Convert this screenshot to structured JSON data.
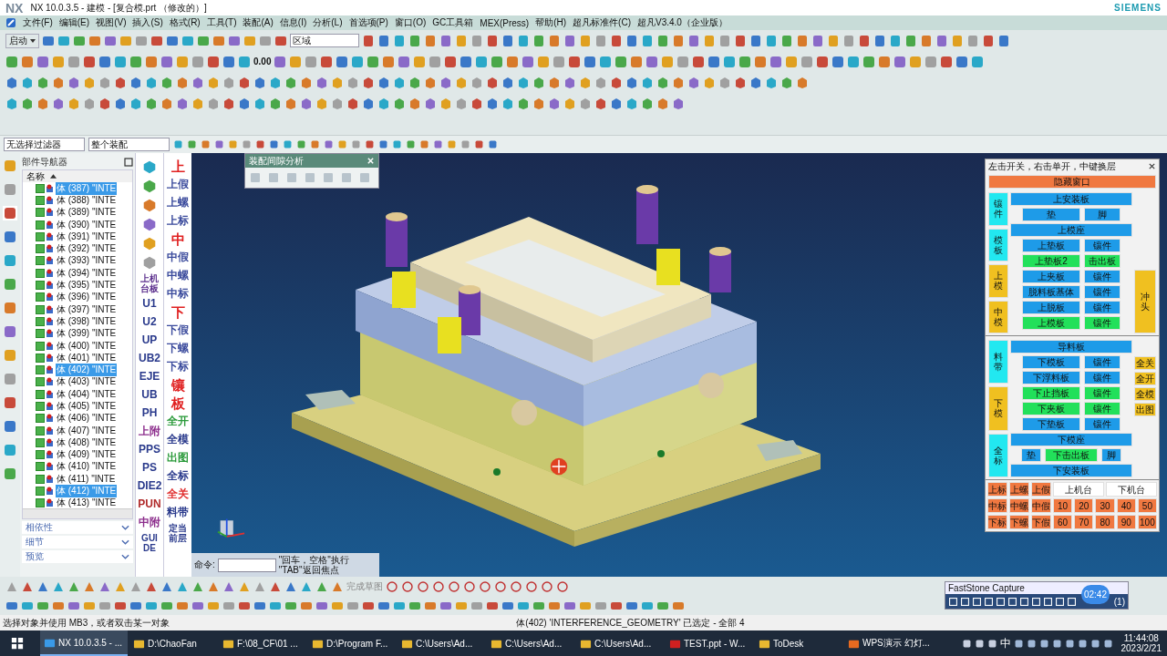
{
  "window": {
    "logo": "NX",
    "title": "NX 10.0.3.5 - 建模 - [复合模.prt （修改的）]",
    "brand": "SIEMENS"
  },
  "menu": [
    "文件(F)",
    "编辑(E)",
    "视图(V)",
    "插入(S)",
    "格式(R)",
    "工具(T)",
    "装配(A)",
    "信息(I)",
    "分析(L)",
    "首选项(P)",
    "窗口(O)",
    "GC工具箱",
    "MEX(Press)",
    "帮助(H)",
    "超凡标准件(C)",
    "超凡V3.4.0（企业版）"
  ],
  "toolbar": {
    "start": "启动",
    "region": "区域",
    "value": "0.00",
    "filter": "无选择过滤器",
    "scope": "整个装配"
  },
  "navigator": {
    "title": "部件导航器",
    "column": "名称",
    "rows": [
      {
        "label": "体 (387) \"INTE",
        "checked": true,
        "selected": true
      },
      {
        "label": "体 (388) \"INTE",
        "checked": true,
        "selected": false
      },
      {
        "label": "体 (389) \"INTE",
        "checked": true,
        "selected": false
      },
      {
        "label": "体 (390) \"INTE",
        "checked": true,
        "selected": false
      },
      {
        "label": "体 (391) \"INTE",
        "checked": true,
        "selected": false
      },
      {
        "label": "体 (392) \"INTE",
        "checked": true,
        "selected": false
      },
      {
        "label": "体 (393) \"INTE",
        "checked": true,
        "selected": false
      },
      {
        "label": "体 (394) \"INTE",
        "checked": true,
        "selected": false
      },
      {
        "label": "体 (395) \"INTE",
        "checked": true,
        "selected": false
      },
      {
        "label": "体 (396) \"INTE",
        "checked": true,
        "selected": false
      },
      {
        "label": "体 (397) \"INTE",
        "checked": true,
        "selected": false
      },
      {
        "label": "体 (398) \"INTE",
        "checked": true,
        "selected": false
      },
      {
        "label": "体 (399) \"INTE",
        "checked": true,
        "selected": false
      },
      {
        "label": "体 (400) \"INTE",
        "checked": true,
        "selected": false
      },
      {
        "label": "体 (401) \"INTE",
        "checked": true,
        "selected": false
      },
      {
        "label": "体 (402) \"INTE",
        "checked": true,
        "selected": true
      },
      {
        "label": "体 (403) \"INTE",
        "checked": true,
        "selected": false
      },
      {
        "label": "体 (404) \"INTE",
        "checked": true,
        "selected": false
      },
      {
        "label": "体 (405) \"INTE",
        "checked": true,
        "selected": false
      },
      {
        "label": "体 (406) \"INTE",
        "checked": true,
        "selected": false
      },
      {
        "label": "体 (407) \"INTE",
        "checked": true,
        "selected": false
      },
      {
        "label": "体 (408) \"INTE",
        "checked": true,
        "selected": false
      },
      {
        "label": "体 (409) \"INTE",
        "checked": true,
        "selected": false
      },
      {
        "label": "体 (410) \"INTE",
        "checked": true,
        "selected": false
      },
      {
        "label": "体 (411) \"INTE",
        "checked": true,
        "selected": false
      },
      {
        "label": "体 (412) \"INTE",
        "checked": true,
        "selected": true
      },
      {
        "label": "体 (413) \"INTE",
        "checked": true,
        "selected": false
      }
    ],
    "sections": [
      {
        "label": "相依性",
        "expanded": false
      },
      {
        "label": "细节",
        "expanded": false
      },
      {
        "label": "预览",
        "expanded": false
      }
    ]
  },
  "vertical_toolbars": [
    [
      {
        "kind": "icon"
      },
      {
        "kind": "icon"
      },
      {
        "kind": "icon"
      },
      {
        "kind": "icon"
      },
      {
        "kind": "icon"
      },
      {
        "kind": "icon"
      },
      {
        "kind": "small",
        "label": "上机台板",
        "color": "#5a2d8c"
      },
      {
        "kind": "text",
        "label": "U1",
        "color": "#2a3a8c"
      },
      {
        "kind": "text",
        "label": "U2",
        "color": "#2a3a8c"
      },
      {
        "kind": "text",
        "label": "UP",
        "color": "#2a3a8c"
      },
      {
        "kind": "text",
        "label": "UB2",
        "color": "#2a3a8c"
      },
      {
        "kind": "text",
        "label": "EJE",
        "color": "#2a3a8c"
      },
      {
        "kind": "text",
        "label": "UB",
        "color": "#2a3a8c"
      },
      {
        "kind": "text",
        "label": "PH",
        "color": "#2a3a8c"
      },
      {
        "kind": "text",
        "label": "上附",
        "color": "#8c2d8c"
      },
      {
        "kind": "text",
        "label": "PPS",
        "color": "#2a3a8c"
      },
      {
        "kind": "text",
        "label": "PS",
        "color": "#2a3a8c"
      },
      {
        "kind": "text",
        "label": "DIE2",
        "color": "#2a3a8c"
      },
      {
        "kind": "text",
        "label": "PUN",
        "color": "#b02a2a"
      },
      {
        "kind": "text",
        "label": "中附",
        "color": "#8c2d8c"
      },
      {
        "kind": "small",
        "label": "GUIDE",
        "color": "#2a3a8c"
      }
    ],
    [
      {
        "kind": "big",
        "label": "上",
        "color": "#e02020"
      },
      {
        "kind": "text",
        "label": "上假",
        "color": "#3a4a9c"
      },
      {
        "kind": "text",
        "label": "上螺",
        "color": "#3a4a9c"
      },
      {
        "kind": "text",
        "label": "上标",
        "color": "#3a4a9c"
      },
      {
        "kind": "big",
        "label": "中",
        "color": "#e02020"
      },
      {
        "kind": "text",
        "label": "中假",
        "color": "#3a4a9c"
      },
      {
        "kind": "text",
        "label": "中螺",
        "color": "#3a4a9c"
      },
      {
        "kind": "text",
        "label": "中标",
        "color": "#3a4a9c"
      },
      {
        "kind": "big",
        "label": "下",
        "color": "#e02020"
      },
      {
        "kind": "text",
        "label": "下假",
        "color": "#3a4a9c"
      },
      {
        "kind": "text",
        "label": "下螺",
        "color": "#3a4a9c"
      },
      {
        "kind": "text",
        "label": "下标",
        "color": "#3a4a9c"
      },
      {
        "kind": "big",
        "label": "镶",
        "color": "#e02020"
      },
      {
        "kind": "big",
        "label": "板",
        "color": "#e02020"
      },
      {
        "kind": "text",
        "label": "全开",
        "color": "#2a9a3a"
      },
      {
        "kind": "text",
        "label": "全模",
        "color": "#2a3a8c"
      },
      {
        "kind": "text",
        "label": "出图",
        "color": "#2a9a3a"
      },
      {
        "kind": "text",
        "label": "全标",
        "color": "#2a3a8c"
      },
      {
        "kind": "text",
        "label": "全关",
        "color": "#e03030"
      },
      {
        "kind": "text",
        "label": "料带",
        "color": "#2a3a8c"
      },
      {
        "kind": "small",
        "label": "定当前层",
        "color": "#2a3a8c"
      }
    ]
  ],
  "analysis_dialog": {
    "title": "装配间隙分析"
  },
  "command": {
    "label": "命令:",
    "hint": "\"回车，空格\"执行 \"TAB\"返回焦点"
  },
  "layer_panel": {
    "title": "左击开关，右击单开，中键换层",
    "hide": {
      "label": "隐藏窗口",
      "color": "#f07840"
    },
    "upper": {
      "side": [
        {
          "label": "镶件",
          "color": "#22e8f0"
        },
        {
          "label": "模板",
          "color": "#22e8f0"
        },
        {
          "label": "上模",
          "color": "#f0c020"
        },
        {
          "label": "中模",
          "color": "#f0c020"
        }
      ],
      "rows": [
        [
          {
            "label": "上安装板",
            "color": "#1e9be8"
          }
        ],
        [
          {
            "label": "垫",
            "color": "#1e9be8"
          },
          {
            "label": "脚",
            "color": "#1e9be8"
          }
        ],
        [
          {
            "label": "上模座",
            "color": "#1e9be8"
          }
        ],
        [
          {
            "label": "上垫板",
            "color": "#1e9be8"
          },
          {
            "label": "镶件",
            "color": "#1e9be8"
          }
        ],
        [
          {
            "label": "上垫板2",
            "color": "#22e05a"
          },
          {
            "label": "击出板",
            "color": "#22e05a"
          }
        ],
        [
          {
            "label": "上夹板",
            "color": "#1e9be8"
          },
          {
            "label": "镶件",
            "color": "#1e9be8"
          }
        ],
        [
          {
            "label": "脱料板基体",
            "color": "#1e9be8"
          },
          {
            "label": "镶件",
            "color": "#1e9be8"
          }
        ],
        [
          {
            "label": "上脱板",
            "color": "#1e9be8"
          },
          {
            "label": "镶件",
            "color": "#1e9be8"
          }
        ],
        [
          {
            "label": "上模板",
            "color": "#22e05a"
          },
          {
            "label": "镶件",
            "color": "#22e05a"
          }
        ]
      ],
      "right": [
        {
          "label": "冲头",
          "color": "#f0c020"
        }
      ]
    },
    "lower": {
      "side": [
        {
          "label": "料带",
          "color": "#22e8f0"
        },
        {
          "label": "下模",
          "color": "#f0c020"
        },
        {
          "label": "全标",
          "color": "#22e8f0"
        }
      ],
      "rows": [
        [
          {
            "label": "导料板",
            "color": "#1e9be8"
          }
        ],
        [
          {
            "label": "下模板",
            "color": "#1e9be8"
          },
          {
            "label": "镶件",
            "color": "#1e9be8"
          }
        ],
        [
          {
            "label": "下浮料板",
            "color": "#1e9be8"
          },
          {
            "label": "镶件",
            "color": "#1e9be8"
          }
        ],
        [
          {
            "label": "下止挡板",
            "color": "#22e05a"
          },
          {
            "label": "镶件",
            "color": "#22e05a"
          }
        ],
        [
          {
            "label": "下夹板",
            "color": "#22e05a"
          },
          {
            "label": "镶件",
            "color": "#22e05a"
          }
        ],
        [
          {
            "label": "下垫板",
            "color": "#1e9be8"
          },
          {
            "label": "镶件",
            "color": "#1e9be8"
          }
        ],
        [
          {
            "label": "下模座",
            "color": "#1e9be8"
          }
        ],
        [
          {
            "label": "垫",
            "color": "#1e9be8"
          },
          {
            "label": "下击出板",
            "color": "#22e05a"
          },
          {
            "label": "脚",
            "color": "#1e9be8"
          }
        ],
        [
          {
            "label": "下安装板",
            "color": "#1e9be8"
          }
        ]
      ],
      "right": [
        {
          "label": "全关",
          "color": "#f0c020"
        },
        {
          "label": "全开",
          "color": "#f0c020"
        },
        {
          "label": "全模",
          "color": "#f0c020"
        },
        {
          "label": "出图",
          "color": "#f0c020"
        }
      ]
    },
    "grid": [
      [
        {
          "label": "上标",
          "color": "#f07840"
        },
        {
          "label": "上螺",
          "color": "#f07840"
        },
        {
          "label": "上假",
          "color": "#f07840"
        },
        {
          "label": "上机台",
          "color": "#ffffff"
        },
        {
          "label": "下机台",
          "color": "#ffffff"
        }
      ],
      [
        {
          "label": "中标",
          "color": "#f07840"
        },
        {
          "label": "中螺",
          "color": "#f07840"
        },
        {
          "label": "中假",
          "color": "#f07840"
        },
        {
          "label": "10",
          "color": "#f07840"
        },
        {
          "label": "20",
          "color": "#f07840"
        },
        {
          "label": "30",
          "color": "#f07840"
        },
        {
          "label": "40",
          "color": "#f07840"
        },
        {
          "label": "50",
          "color": "#f07840"
        }
      ],
      [
        {
          "label": "下标",
          "color": "#f07840"
        },
        {
          "label": "下螺",
          "color": "#f07840"
        },
        {
          "label": "下假",
          "color": "#f07840"
        },
        {
          "label": "60",
          "color": "#f07840"
        },
        {
          "label": "70",
          "color": "#f07840"
        },
        {
          "label": "80",
          "color": "#f07840"
        },
        {
          "label": "90",
          "color": "#f07840"
        },
        {
          "label": "100",
          "color": "#f07840"
        }
      ]
    ]
  },
  "sketch_toolbar": {
    "finish": "完成草图"
  },
  "capture": {
    "title": "FastStone Capture",
    "timer": "02:42",
    "count": "(1)"
  },
  "status_bar": {
    "prompt": "选择对象并使用 MB3，或者双击某一对象",
    "selection": "体(402) 'INTERFERENCE_GEOMETRY' 已选定 - 全部 4"
  },
  "taskbar": {
    "items": [
      {
        "label": "NX 10.0.3.5 - ...",
        "selected": true
      },
      {
        "label": "D:\\ChaoFan",
        "selected": false
      },
      {
        "label": "F:\\08_CF\\01 ...",
        "selected": false
      },
      {
        "label": "D:\\Program F...",
        "selected": false
      },
      {
        "label": "C:\\Users\\Ad...",
        "selected": false
      },
      {
        "label": "C:\\Users\\Ad...",
        "selected": false
      },
      {
        "label": "C:\\Users\\Ad...",
        "selected": false
      },
      {
        "label": "TEST.ppt - W...",
        "selected": false
      },
      {
        "label": "ToDesk",
        "selected": false
      },
      {
        "label": "WPS演示 幻灯...",
        "selected": false
      }
    ],
    "ime": "中",
    "time": "11:44:08",
    "date": "2023/2/21"
  }
}
